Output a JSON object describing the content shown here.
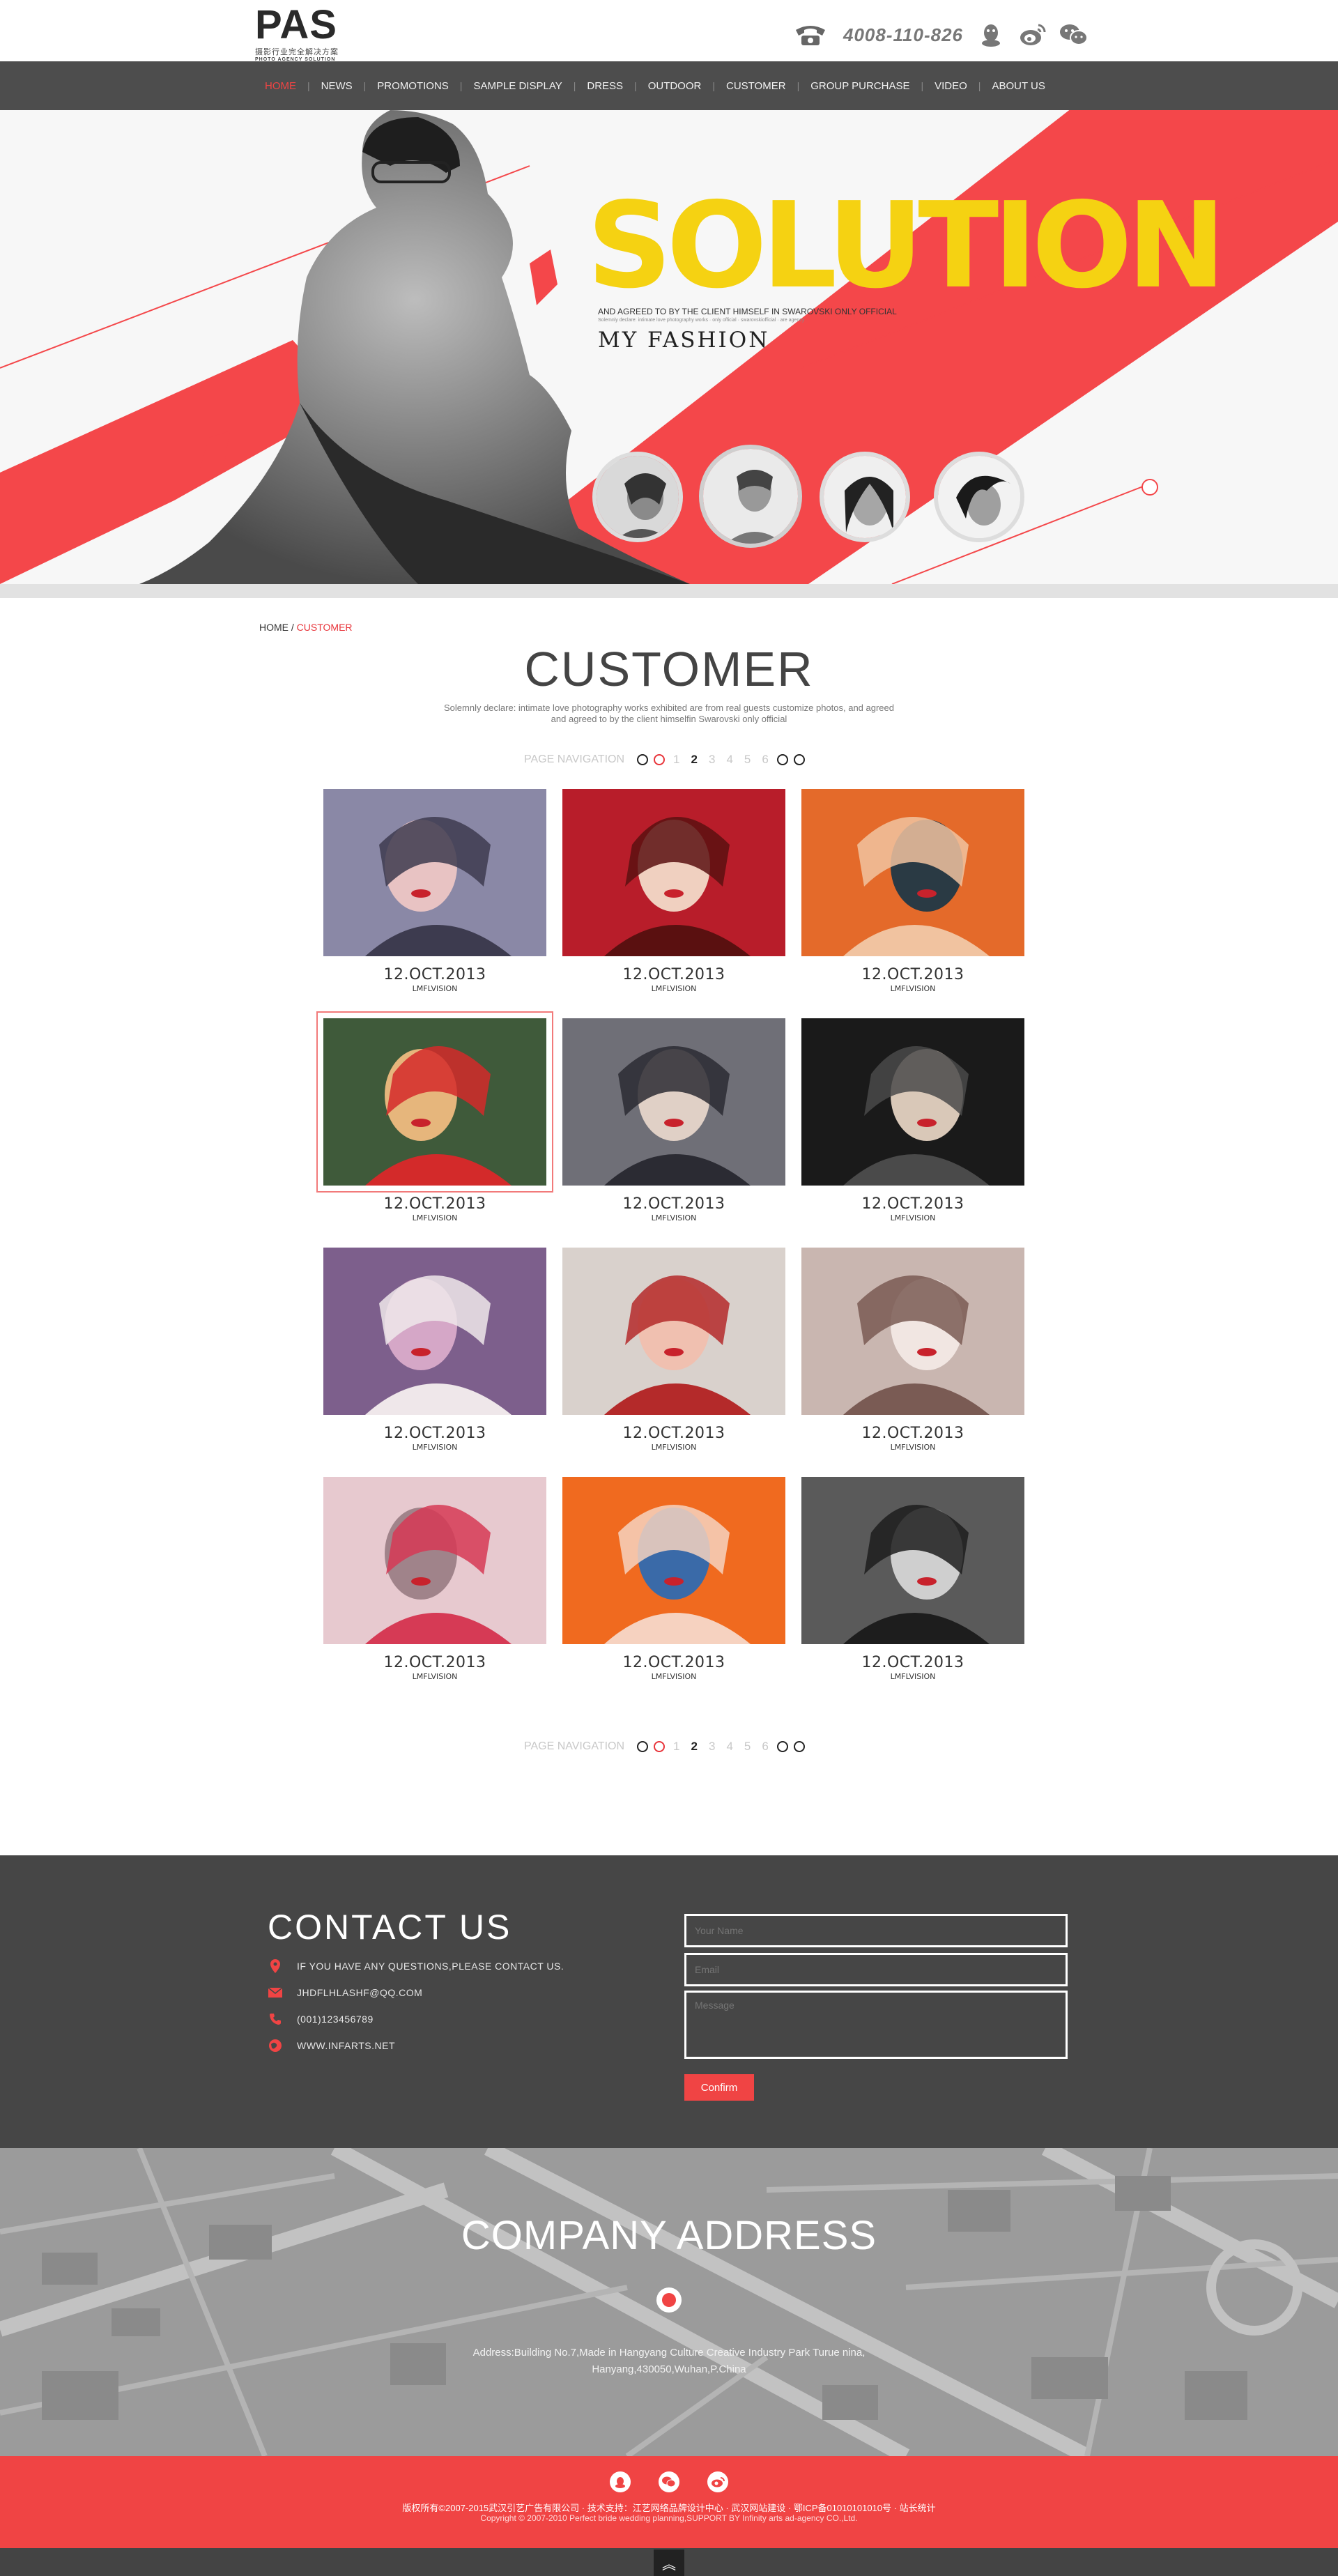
{
  "header": {
    "logo": {
      "main": "PAS",
      "cn": "摄影行业完全解决方案",
      "en": "PHOTO AGENCY SOLUTION"
    },
    "phone": "4008-110-826",
    "icons": [
      "phone-icon",
      "qq-icon",
      "weibo-icon",
      "wechat-icon"
    ]
  },
  "nav": {
    "items": [
      "HOME",
      "NEWS",
      "PROMOTIONS",
      "SAMPLE DISPLAY",
      "DRESS",
      "OUTDOOR",
      "CUSTOMER",
      "GROUP PURCHASE",
      "VIDEO",
      "ABOUT US"
    ],
    "active_index": 0,
    "separator": "|"
  },
  "banner": {
    "headline": "SOLUTION",
    "subline": "AND AGREED TO BY THE CLIENT HIMSELF IN SWAROVSKI ONLY OFFICIAL",
    "tiny": "Solemnly declare: intimate love photography works · only official · swarovskiofficial · are agency",
    "tagline": "MY  FASHION"
  },
  "breadcrumb": {
    "home": "HOME",
    "sep": " / ",
    "current": "CUSTOMER"
  },
  "page": {
    "title": "CUSTOMER",
    "desc_1": "Solemnly declare: intimate love photography works exhibited are from real guests customize photos, and agreed",
    "desc_2": "and agreed to by the client himselfin Swarovski only official"
  },
  "pager": {
    "label": "PAGE NAVIGATION",
    "pages": [
      "1",
      "2",
      "3",
      "4",
      "5",
      "6"
    ],
    "current": "2"
  },
  "gallery": [
    {
      "date": "12.OCT.2013",
      "caption": "LMFLVISION"
    },
    {
      "date": "12.OCT.2013",
      "caption": "LMFLVISION"
    },
    {
      "date": "12.OCT.2013",
      "caption": "LMFLVISION"
    },
    {
      "date": "12.OCT.2013",
      "caption": "LMFLVISION"
    },
    {
      "date": "12.OCT.2013",
      "caption": "LMFLVISION"
    },
    {
      "date": "12.OCT.2013",
      "caption": "LMFLVISION"
    },
    {
      "date": "12.OCT.2013",
      "caption": "LMFLVISION"
    },
    {
      "date": "12.OCT.2013",
      "caption": "LMFLVISION"
    },
    {
      "date": "12.OCT.2013",
      "caption": "LMFLVISION"
    },
    {
      "date": "12.OCT.2013",
      "caption": "LMFLVISION"
    },
    {
      "date": "12.OCT.2013",
      "caption": "LMFLVISION"
    },
    {
      "date": "12.OCT.2013",
      "caption": "LMFLVISION"
    }
  ],
  "contact": {
    "title": "CONTACT  US",
    "rows": [
      {
        "icon": "location-icon",
        "text": "IF YOU HAVE ANY QUESTIONS,PLEASE CONTACT  US."
      },
      {
        "icon": "mail-icon",
        "text": "JHDFLHLASHF@QQ.COM"
      },
      {
        "icon": "phone-icon",
        "text": "(001)123456789"
      },
      {
        "icon": "globe-icon",
        "text": "WWW.INFARTS.NET"
      }
    ],
    "form": {
      "name_placeholder": "Your Name",
      "email_placeholder": "Email",
      "message_placeholder": "Message",
      "submit": "Confirm"
    }
  },
  "map": {
    "title": "COMPANY ADDRESS",
    "address_1": "Address:Building No.7,Made in Hangyang Culture Creative Industry Park Turue nina,",
    "address_2": "Hanyang,430050,Wuhan,P.China"
  },
  "footer": {
    "icons": [
      "qq-icon",
      "wechat-icon",
      "weibo-icon"
    ],
    "line_1": "版权所有©2007-2015武汉引艺广告有限公司 · 技术支持：江艺网络品牌设计中心 · 武汉网站建设 · 鄂ICP备01010101010号 · 站长统计",
    "line_2": "Copyright © 2007-2010 Perfect bride wedding planning,SUPPORT BY Infinity arts ad-agency CO.,Ltd.",
    "totop": "︽"
  },
  "colors": {
    "accent": "#f04444",
    "nav_bg": "#4d4d4d",
    "contact_bg": "#464646",
    "headline": "#f5d212"
  }
}
